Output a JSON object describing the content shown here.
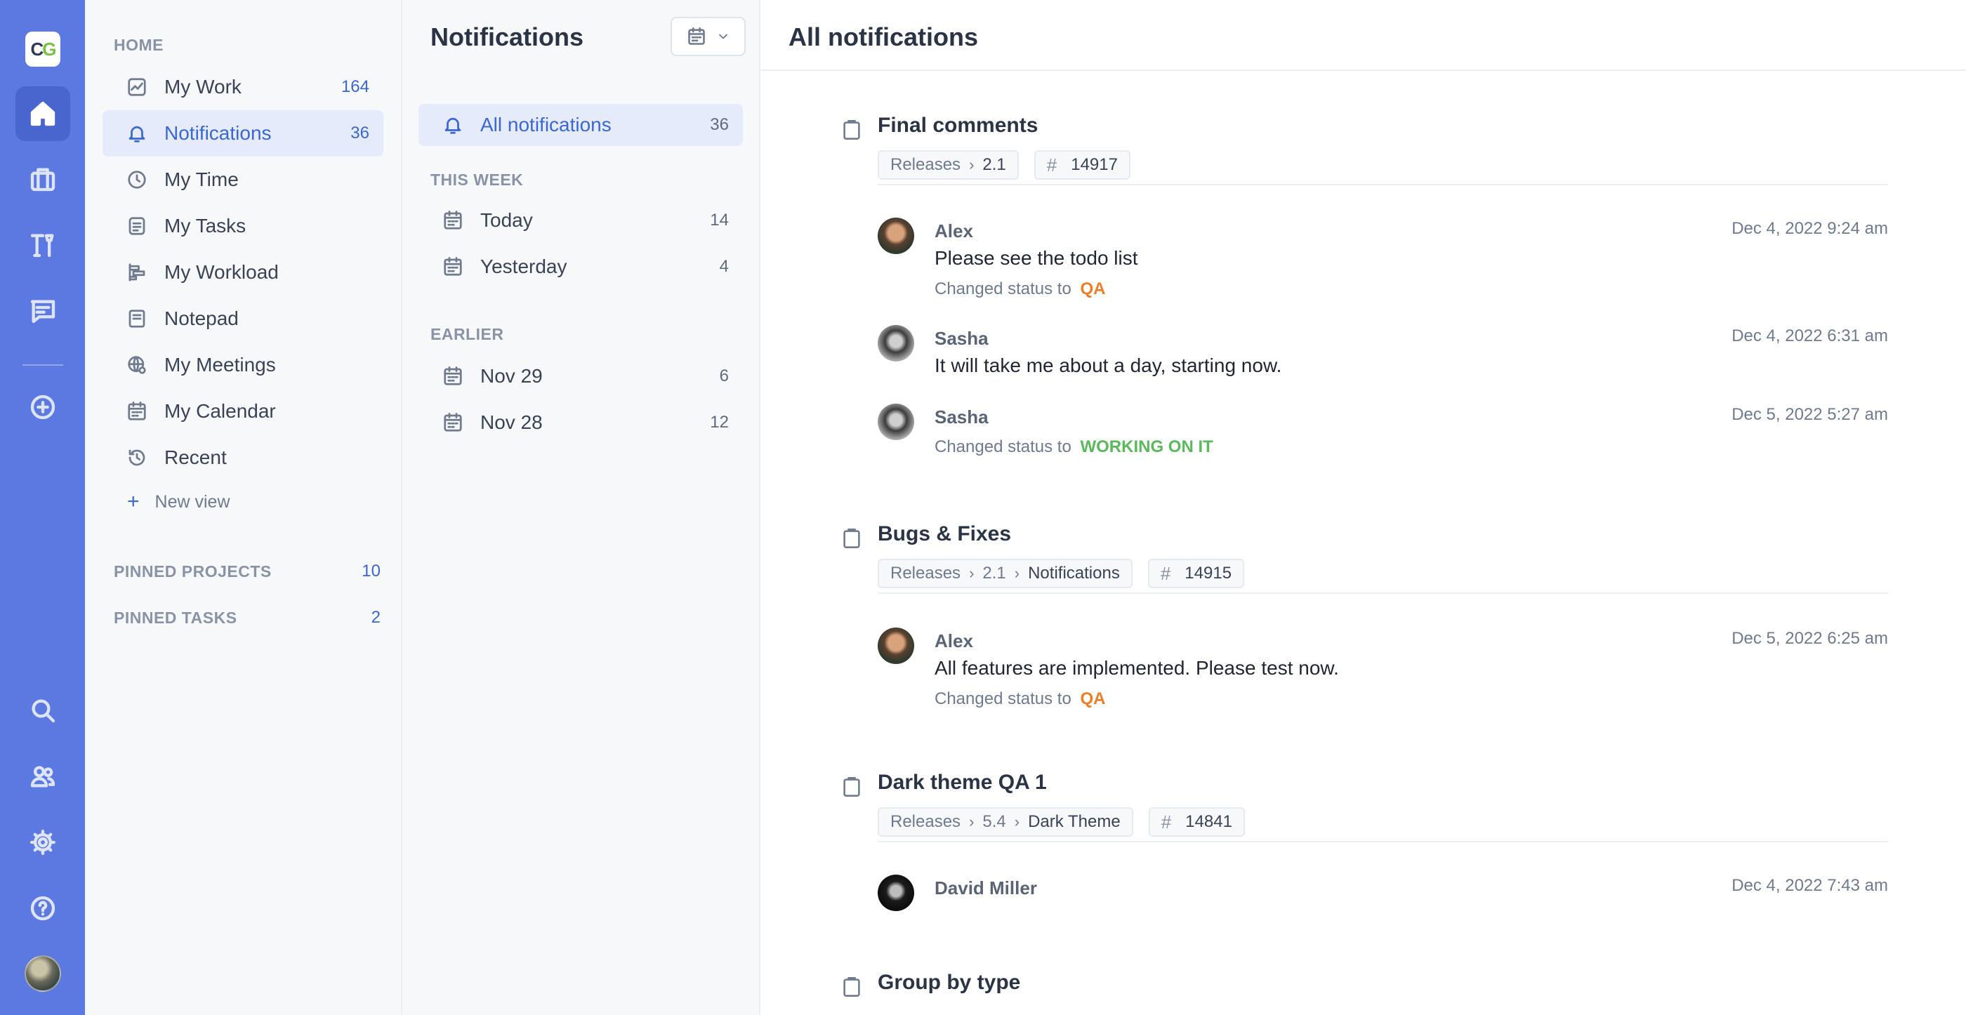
{
  "rail": {
    "logo": {
      "left": "C",
      "right": "G"
    },
    "icons": [
      "home-icon",
      "briefcase-icon",
      "tools-icon",
      "chat-icon",
      "add-circle-icon",
      "search-icon",
      "users-icon",
      "gear-icon",
      "help-icon"
    ]
  },
  "nav": {
    "home_heading": "HOME",
    "items": [
      {
        "label": "My Work",
        "count": "164",
        "icon": "chart-icon"
      },
      {
        "label": "Notifications",
        "count": "36",
        "icon": "bell-icon"
      },
      {
        "label": "My Time",
        "count": "",
        "icon": "clock-icon"
      },
      {
        "label": "My Tasks",
        "count": "",
        "icon": "tasks-icon"
      },
      {
        "label": "My Workload",
        "count": "",
        "icon": "workload-icon"
      },
      {
        "label": "Notepad",
        "count": "",
        "icon": "notepad-icon"
      },
      {
        "label": "My Meetings",
        "count": "",
        "icon": "globe-icon"
      },
      {
        "label": "My Calendar",
        "count": "",
        "icon": "calendar-icon"
      },
      {
        "label": "Recent",
        "count": "",
        "icon": "history-icon"
      }
    ],
    "new_view": "New view",
    "pinned_projects": {
      "label": "PINNED PROJECTS",
      "count": "10"
    },
    "pinned_tasks": {
      "label": "PINNED TASKS",
      "count": "2"
    }
  },
  "mid": {
    "title": "Notifications",
    "all": {
      "label": "All notifications",
      "count": "36"
    },
    "this_week_heading": "THIS WEEK",
    "this_week": [
      {
        "label": "Today",
        "count": "14"
      },
      {
        "label": "Yesterday",
        "count": "4"
      }
    ],
    "earlier_heading": "EARLIER",
    "earlier": [
      {
        "label": "Nov 29",
        "count": "6"
      },
      {
        "label": "Nov 28",
        "count": "12"
      }
    ]
  },
  "main": {
    "title": "All notifications",
    "groups": [
      {
        "title": "Final comments",
        "crumbs": [
          "Releases",
          "2.1"
        ],
        "task_id": "14917",
        "messages": [
          {
            "author": "Alex",
            "date": "Dec 4, 2022 9:24 am",
            "text": "Please see the todo list",
            "status_prefix": "Changed status to",
            "status": "QA"
          },
          {
            "author": "Sasha",
            "date": "Dec 4, 2022 6:31 am",
            "text": "It will take me about a day, starting now."
          },
          {
            "author": "Sasha",
            "date": "Dec 5, 2022 5:27 am",
            "status_prefix": "Changed status to",
            "status": "WORKING ON IT"
          }
        ]
      },
      {
        "title": "Bugs & Fixes",
        "crumbs": [
          "Releases",
          "2.1",
          "Notifications"
        ],
        "task_id": "14915",
        "messages": [
          {
            "author": "Alex",
            "date": "Dec 5, 2022 6:25 am",
            "text": "All features are implemented. Please test now.",
            "status_prefix": "Changed status to",
            "status": "QA"
          }
        ]
      },
      {
        "title": "Dark theme QA 1",
        "crumbs": [
          "Releases",
          "5.4",
          "Dark Theme"
        ],
        "task_id": "14841",
        "messages": [
          {
            "author": "David Miller",
            "date": "Dec 4, 2022 7:43 am"
          }
        ]
      },
      {
        "title": "Group by type"
      }
    ]
  },
  "colors": {
    "rail": "#5b79e0",
    "accent": "#3a67d4",
    "status_qa": "#ee7d27",
    "status_working": "#5cb85c"
  }
}
